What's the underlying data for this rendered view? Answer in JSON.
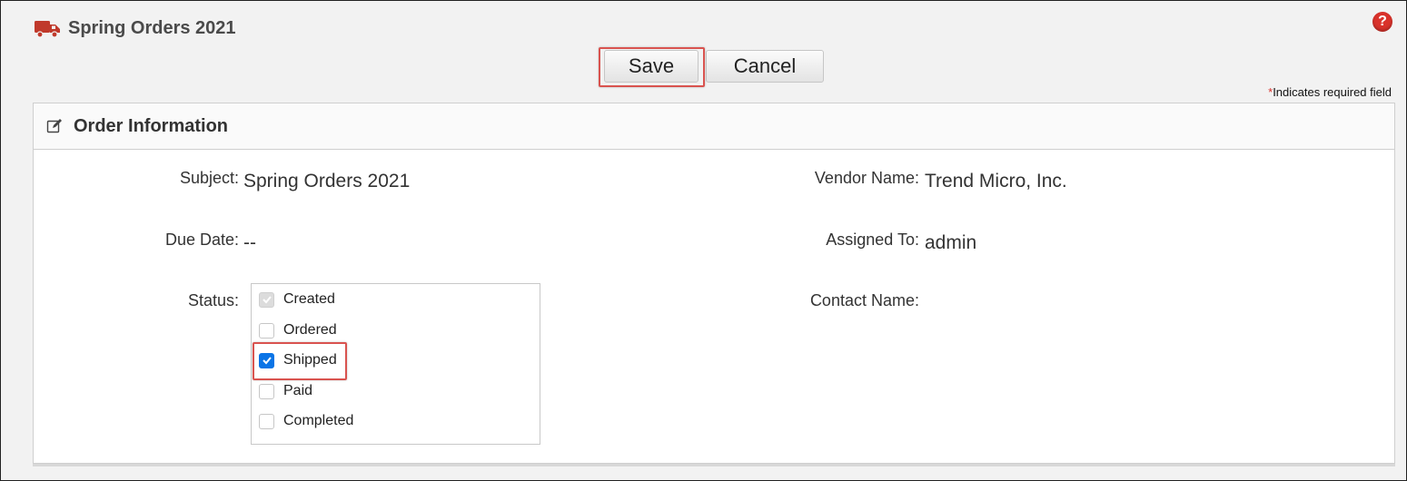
{
  "header": {
    "title": "Spring Orders 2021",
    "title_icon": "truck-icon",
    "help_icon": "help-icon",
    "help_glyph": "?"
  },
  "toolbar": {
    "save_label": "Save",
    "cancel_label": "Cancel"
  },
  "required_note": {
    "star": "*",
    "text": "Indicates required field"
  },
  "panel": {
    "title": "Order Information",
    "icon": "edit-icon"
  },
  "fields": {
    "subject_label": "Subject:",
    "subject_value": "Spring Orders 2021",
    "due_date_label": "Due Date:",
    "due_date_value": "--",
    "status_label": "Status:",
    "vendor_label": "Vendor Name:",
    "vendor_value": "Trend Micro, Inc.",
    "assigned_label": "Assigned To:",
    "assigned_value": "admin",
    "contact_label": "Contact Name:"
  },
  "status_options": [
    {
      "label": "Created",
      "checked": true,
      "disabled": true
    },
    {
      "label": "Ordered",
      "checked": false,
      "disabled": false
    },
    {
      "label": "Shipped",
      "checked": true,
      "disabled": false
    },
    {
      "label": "Paid",
      "checked": false,
      "disabled": false
    },
    {
      "label": "Completed",
      "checked": false,
      "disabled": false
    }
  ],
  "colors": {
    "accent_red": "#d9322b",
    "highlight_border": "#d9534f",
    "checkbox_blue": "#0a74e6"
  }
}
